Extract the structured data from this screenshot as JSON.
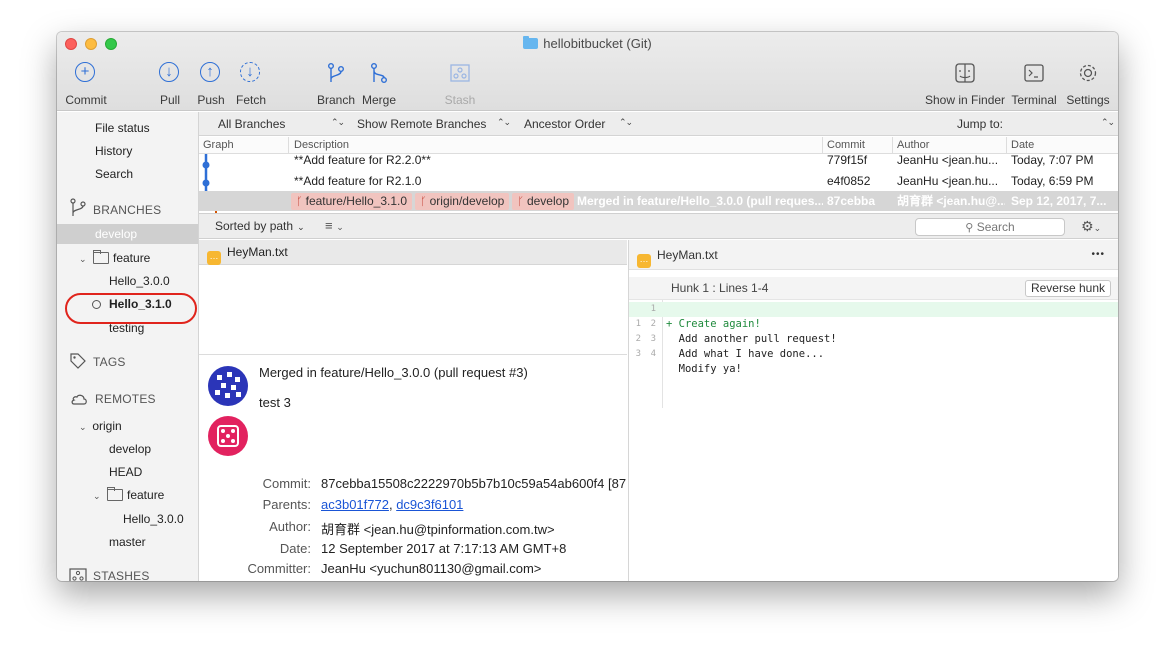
{
  "window": {
    "title": "hellobitbucket (Git)"
  },
  "toolbar": {
    "buttons": [
      {
        "label": "Commit"
      },
      {
        "label": "Pull"
      },
      {
        "label": "Push"
      },
      {
        "label": "Fetch"
      },
      {
        "label": "Branch"
      },
      {
        "label": "Merge"
      },
      {
        "label": "Stash"
      },
      {
        "label": "Show in Finder"
      },
      {
        "label": "Terminal"
      },
      {
        "label": "Settings"
      }
    ]
  },
  "sidebar": {
    "workspace": [
      "File status",
      "History",
      "Search"
    ],
    "branches_title": "BRANCHES",
    "branches": {
      "develop": "develop",
      "feature_folder": "feature",
      "hello300": "Hello_3.0.0",
      "hello310": "Hello_3.1.0",
      "testing": "testing"
    },
    "tags_title": "TAGS",
    "remotes_title": "REMOTES",
    "remotes": {
      "origin": "origin",
      "develop": "develop",
      "head": "HEAD",
      "feature_folder": "feature",
      "hello300": "Hello_3.0.0",
      "master": "master"
    },
    "stashes_title": "STASHES"
  },
  "filter": {
    "branches": "All Branches",
    "remote": "Show Remote Branches",
    "order": "Ancestor Order",
    "jump_to": "Jump to:"
  },
  "columns": {
    "graph": "Graph",
    "description": "Description",
    "commit": "Commit",
    "author": "Author",
    "date": "Date"
  },
  "commits": [
    {
      "description": "**Add feature for R2.2.0**",
      "commit": "779f15f",
      "author": "JeanHu <jean.hu...",
      "date": "Today, 7:07 PM"
    },
    {
      "description": "**Add feature for R2.1.0",
      "commit": "e4f0852",
      "author": "JeanHu <jean.hu...",
      "date": "Today, 6:59 PM"
    },
    {
      "tags": [
        "feature/Hello_3.1.0",
        "origin/develop",
        "develop"
      ],
      "description": "Merged in feature/Hello_3.0.0 (pull reques...",
      "commit": "87cebba",
      "author": "胡育群 <jean.hu@...",
      "date": "Sep 12, 2017, 7..."
    }
  ],
  "midbar": {
    "sort": "Sorted by path",
    "search_placeholder": "Search"
  },
  "file": {
    "name": "HeyMan.txt"
  },
  "details": {
    "message": "Merged in feature/Hello_3.0.0 (pull request #3)",
    "body": "test 3",
    "commit_label": "Commit:",
    "commit": "87cebba15508c2222970b5b7b10c59a54ab600f4 [87",
    "parents_label": "Parents:",
    "parent1": "ac3b01f772",
    "parent_sep": ", ",
    "parent2": "dc9c3f6101",
    "author_label": "Author:",
    "author": "胡育群 <jean.hu@tpinformation.com.tw>",
    "date_label": "Date:",
    "date": "12 September 2017 at 7:17:13 AM GMT+8",
    "committer_label": "Committer:",
    "committer": "JeanHu <yuchun801130@gmail.com>"
  },
  "diff": {
    "file": "HeyMan.txt",
    "more": "•••",
    "hunk": "Hunk 1 : Lines 1-4",
    "reverse_hunk": "Reverse hunk",
    "lines": [
      {
        "old": "",
        "new": "1",
        "text": "+ Create again!"
      },
      {
        "old": "1",
        "new": "2",
        "text": "  Add another pull request!"
      },
      {
        "old": "2",
        "new": "3",
        "text": "  Add what I have done..."
      },
      {
        "old": "3",
        "new": "4",
        "text": "  Modify ya!"
      }
    ]
  },
  "colors": {
    "accent": "#2e6fd6",
    "tag_bg": "#f1c4bf",
    "highlight": "#e0241c",
    "added_line": "#e6f9ec"
  }
}
